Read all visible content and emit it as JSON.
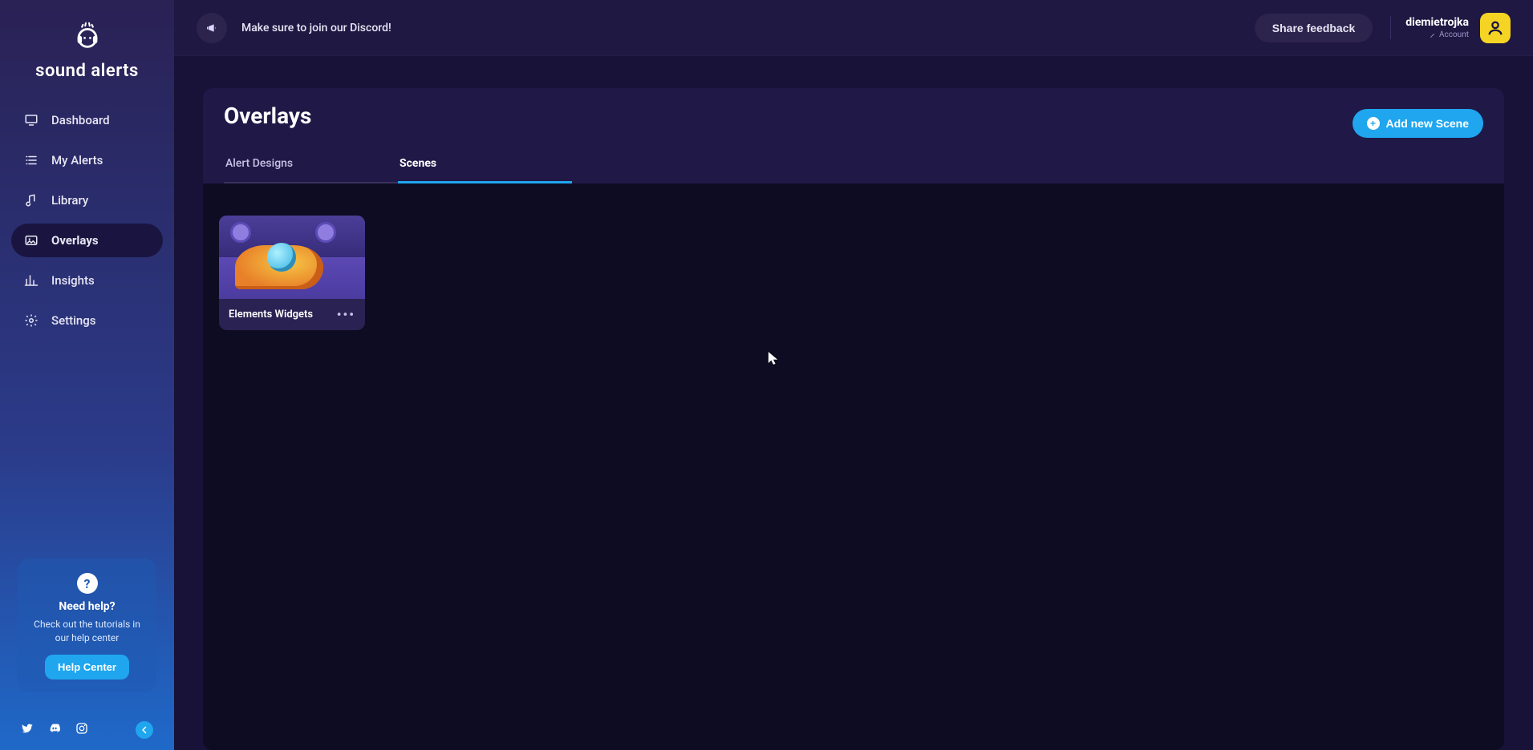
{
  "logo_text": "sound alerts",
  "nav": {
    "dashboard": "Dashboard",
    "my_alerts": "My Alerts",
    "library": "Library",
    "overlays": "Overlays",
    "insights": "Insights",
    "settings": "Settings"
  },
  "help": {
    "title": "Need help?",
    "subtitle": "Check out the tutorials in our help center",
    "button": "Help Center"
  },
  "topbar": {
    "announcement": "Make sure to join our Discord!",
    "feedback_btn": "Share feedback",
    "account_name": "diemietrojka",
    "account_sub": "Account"
  },
  "panel": {
    "title": "Overlays",
    "tab_alert_designs": "Alert Designs",
    "tab_scenes": "Scenes",
    "add_scene_btn": "Add new Scene"
  },
  "scenes": {
    "card0_name": "Elements Widgets"
  }
}
